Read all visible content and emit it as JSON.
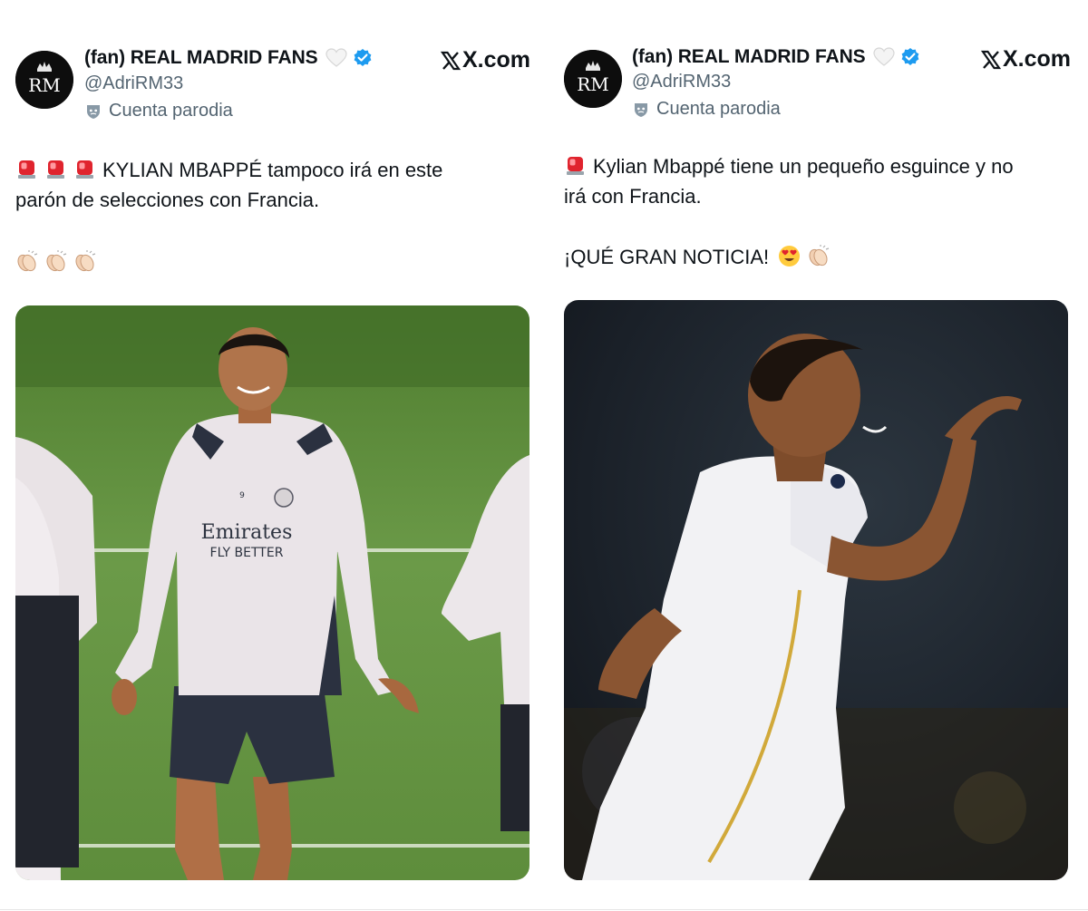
{
  "posts": [
    {
      "author": {
        "display_name": "(fan) REAL MADRID FANS",
        "handle": "@AdriRM33",
        "label": "Cuenta parodia",
        "avatar_text": "RM",
        "avatar_icon": "real-madrid-crest-icon",
        "verified": true
      },
      "source": "X.com",
      "text": {
        "line1": "KYLIAN MBAPPÉ tampoco irá en este",
        "line2": "parón de selecciones con Francia.",
        "emoji_prefix": [
          "police-light-emoji",
          "police-light-emoji",
          "police-light-emoji"
        ],
        "emoji_line": [
          "clapping-hands-emoji",
          "clapping-hands-emoji",
          "clapping-hands-emoji"
        ]
      },
      "media": {
        "type": "photo",
        "subject": "player smiling in white training top with 'Emirates FLY BETTER' sponsor on a football pitch",
        "shirt_text_1": "Emirates",
        "shirt_text_2": "FLY BETTER",
        "shirt_number": "9"
      }
    },
    {
      "author": {
        "display_name": "(fan) REAL MADRID FANS",
        "handle": "@AdriRM33",
        "label": "Cuenta parodia",
        "avatar_text": "RM",
        "avatar_icon": "real-madrid-crest-icon",
        "verified": true
      },
      "source": "X.com",
      "text": {
        "line1": "Kylian Mbappé tiene un pequeño esguince y no",
        "line2": "irá con Francia.",
        "line3": "¡QUÉ GRAN NOTICIA!",
        "emoji_prefix": [
          "police-light-emoji"
        ],
        "emoji_suffix": [
          "heart-eyes-emoji",
          "clapping-hands-emoji"
        ]
      },
      "media": {
        "type": "photo",
        "subject": "player in white match kit celebrating with hand raised in a stadium at night"
      }
    }
  ],
  "colors": {
    "text": "#0f1419",
    "secondary": "#536471",
    "verified_blue": "#1d9bf0",
    "pitch_green": "#5a8a3e",
    "stadium_dark": "#1c232b"
  }
}
